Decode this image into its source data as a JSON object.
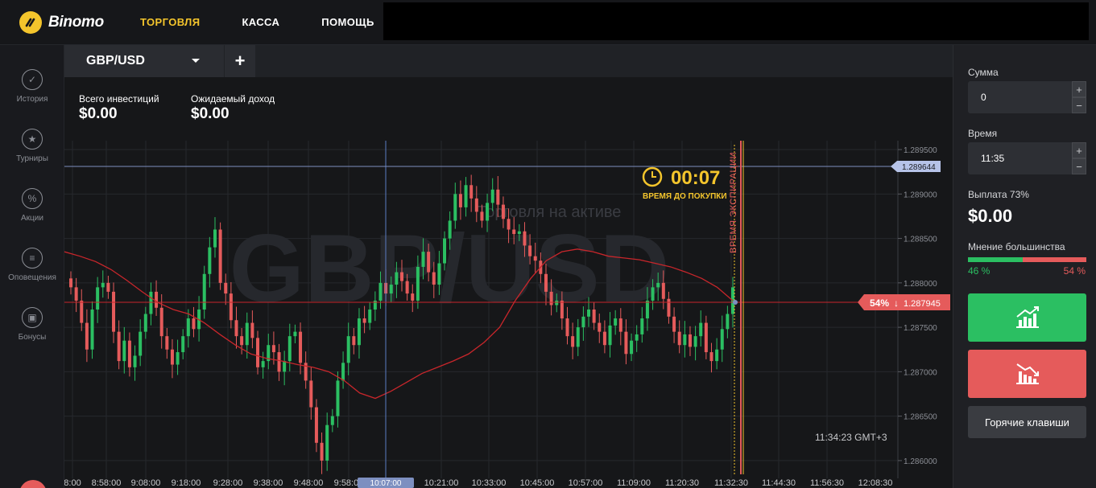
{
  "brand": {
    "name": "Binomo"
  },
  "nav": {
    "items": [
      "ТОРГОВЛЯ",
      "КАССА",
      "ПОМОЩЬ"
    ],
    "active": 0
  },
  "sidebar": {
    "items": [
      {
        "label": "История",
        "icon": "check-circle-icon"
      },
      {
        "label": "Турниры",
        "icon": "trophy-icon"
      },
      {
        "label": "Акции",
        "icon": "percent-icon"
      },
      {
        "label": "Оповещения",
        "icon": "list-icon"
      },
      {
        "label": "Бонусы",
        "icon": "gift-icon"
      }
    ]
  },
  "tab": {
    "asset": "GBP/USD",
    "add": "+"
  },
  "stats": {
    "invested_label": "Всего инвестиций",
    "invested_value": "$0.00",
    "expected_label": "Ожидаемый доход",
    "expected_value": "$0.00"
  },
  "chart": {
    "watermark_asset": "GBP/USD",
    "watermark_sub": "Торговля на активе",
    "timer_value": "00:07",
    "timer_label": "ВРЕМЯ ДО ПОКУПКИ",
    "expiry_label": "ВРЕМЯ ЭКСПИРАЦИИ",
    "clock": "11:34:23 GMT+3",
    "time_marker": "10:07:00",
    "upper_price_tag": "1.289644",
    "current_price_tag": "1.287945",
    "current_majority": "54%",
    "colors": {
      "up": "#2bbf62",
      "down": "#e55b5b",
      "ma": "#c8262b",
      "timer": "#f4c52c"
    }
  },
  "chart_data": {
    "type": "candlestick",
    "y_ticks": [
      "1.289500",
      "1.289000",
      "1.288500",
      "1.288000",
      "1.287500",
      "1.287000",
      "1.286500",
      "1.286000"
    ],
    "x_ticks": [
      "8:00",
      "8:58:00",
      "9:08:00",
      "9:18:00",
      "9:28:00",
      "9:38:00",
      "9:48:00",
      "9:58:00",
      "10:21:00",
      "10:33:00",
      "10:45:00",
      "10:57:00",
      "11:09:00",
      "11:20:30",
      "11:32:30",
      "11:44:30",
      "11:56:30",
      "12:08:30"
    ],
    "ylim": [
      1.2858,
      1.2896
    ],
    "candles_close": [
      1.28795,
      1.2878,
      1.28755,
      1.28725,
      1.2877,
      1.28795,
      1.288,
      1.2879,
      1.28745,
      1.28712,
      1.28735,
      1.28705,
      1.28718,
      1.28745,
      1.28765,
      1.2879,
      1.28772,
      1.2874,
      1.28725,
      1.28708,
      1.28722,
      1.2874,
      1.2876,
      1.28748,
      1.2877,
      1.2881,
      1.2884,
      1.2886,
      1.288,
      1.28788,
      1.28758,
      1.2874,
      1.2873,
      1.28755,
      1.28738,
      1.28705,
      1.28712,
      1.2873,
      1.28722,
      1.287,
      1.28712,
      1.2874,
      1.28745,
      1.2871,
      1.2869,
      1.2866,
      1.2862,
      1.286,
      1.2864,
      1.2865,
      1.2869,
      1.2871,
      1.2874,
      1.2873,
      1.2876,
      1.28755,
      1.2877,
      1.2878,
      1.288,
      1.28788,
      1.28798,
      1.28812,
      1.28802,
      1.28788,
      1.2878,
      1.28818,
      1.28835,
      1.28812,
      1.28798,
      1.28822,
      1.2885,
      1.2887,
      1.289,
      1.28885,
      1.2891,
      1.28895,
      1.2888,
      1.2887,
      1.2889,
      1.28905,
      1.28888,
      1.28872,
      1.2886,
      1.28855,
      1.28858,
      1.28842,
      1.2883,
      1.28825,
      1.2881,
      1.2879,
      1.28775,
      1.2878,
      1.2876,
      1.2874,
      1.28728,
      1.2875,
      1.28762,
      1.2877,
      1.28755,
      1.28745,
      1.2873,
      1.28752,
      1.2876,
      1.28745,
      1.2872,
      1.28735,
      1.28742,
      1.2876,
      1.2878,
      1.28795,
      1.288,
      1.28782,
      1.28762,
      1.28745,
      1.2873,
      1.28742,
      1.28728,
      1.2874,
      1.28755,
      1.28722,
      1.28712,
      1.28725,
      1.28748,
      1.28765,
      1.28795
    ],
    "ma": [
      1.28835,
      1.2883,
      1.28824,
      1.28815,
      1.28803,
      1.2879,
      1.28778,
      1.2877,
      1.28765,
      1.28755,
      1.28742,
      1.2873,
      1.2872,
      1.28715,
      1.28712,
      1.28708,
      1.28705,
      1.287,
      1.2869,
      1.28676,
      1.2867,
      1.28678,
      1.28688,
      1.28698,
      1.28705,
      1.28712,
      1.2872,
      1.28733,
      1.2875,
      1.2878,
      1.28805,
      1.28825,
      1.28835,
      1.28838,
      1.28835,
      1.2883,
      1.28828,
      1.28826,
      1.28822,
      1.28818,
      1.28812,
      1.28805,
      1.28795,
      1.2878
    ]
  },
  "right": {
    "amount_label": "Сумма",
    "amount_value": "0",
    "time_label": "Время",
    "time_value": "11:35",
    "payout_label": "Выплата 73%",
    "payout_value": "$0.00",
    "majority_label": "Мнение большинства",
    "majority_up": "46 %",
    "majority_down": "54 %",
    "majority_up_frac": 0.46,
    "plus": "+",
    "minus": "−",
    "hotkeys": "Горячие клавиши"
  }
}
